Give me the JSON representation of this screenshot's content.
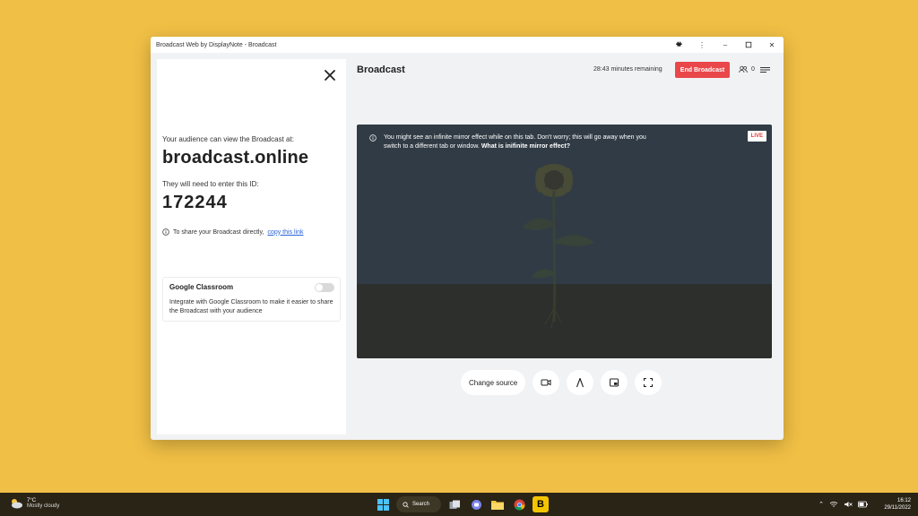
{
  "window": {
    "title": "Broadcast Web by DisplayNote - Broadcast"
  },
  "left_panel": {
    "audience_label": "Your audience can view the Broadcast at:",
    "url": "broadcast.online",
    "id_label": "They will need to enter this ID:",
    "id_number": "172244",
    "share_text": "To share your Broadcast directly,",
    "share_link": "copy this link",
    "google_classroom": {
      "title": "Google Classroom",
      "description": "Integrate with Google Classroom to make it easier to share the Broadcast with your audience",
      "enabled": false
    }
  },
  "header": {
    "title": "Broadcast",
    "remaining": "28:43 minutes remaining",
    "end_button": "End Broadcast",
    "audience_count": "0"
  },
  "video": {
    "notice": "You might see an infinite mirror effect while on this tab. Don't worry; this will go away when you switch to a different tab or window.",
    "notice_question": "What is inifinite mirror effect?",
    "live_badge": "LIVE"
  },
  "controls": {
    "change_source": "Change source"
  },
  "taskbar": {
    "temperature": "7°C",
    "weather": "Mostly cloudy",
    "search": "Search",
    "time": "16:12",
    "date": "29/11/2022"
  },
  "colors": {
    "desktop": "#f0bf45",
    "end_button": "#e9474a",
    "link": "#2a63d8",
    "video_bg": "#313b45"
  }
}
